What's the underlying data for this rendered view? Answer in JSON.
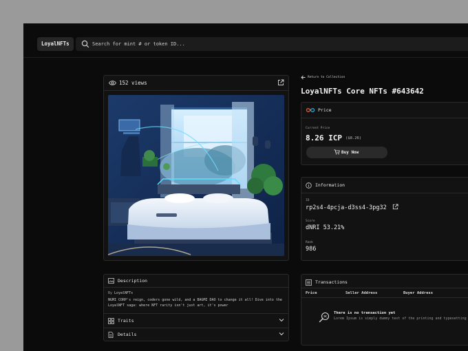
{
  "header": {
    "logo": "LoyalNFTs",
    "search_placeholder": "Search for mint # or token ID..."
  },
  "image_card": {
    "views": "152 views"
  },
  "nav": {
    "back_label": "Return to Collection"
  },
  "nft": {
    "title": "LoyalNFTs Core NFTs #643642"
  },
  "price": {
    "heading": "Price",
    "current_label": "Current Price",
    "value": "8.26 ICP",
    "usd": "($8.26)",
    "buy_label": "Buy Now"
  },
  "information": {
    "heading": "Information",
    "id_label": "ID",
    "id_value": "rp2s4-4pcja-d3ss4-3pg32",
    "score_label": "Score",
    "score_value": "dNRI 53.21%",
    "rank_label": "Rank",
    "rank_value": "986"
  },
  "description": {
    "heading": "Description",
    "by_prefix": "By",
    "by_name": "LoyalNFTs",
    "text": "NGMI CORP's reign, coders gone wild, and a BAGMI DAO to change it all! Dive into the LoyalNFT saga: where NFT rarity isn't just art, it's power"
  },
  "traits": {
    "heading": "Traits"
  },
  "details": {
    "heading": "Details"
  },
  "transactions": {
    "heading": "Transactions",
    "columns": [
      "Price",
      "Seller Address",
      "Buyer Address"
    ],
    "empty_title": "There is no transaction yet",
    "empty_sub": "Lorem Ipsum is simply dummy text of the printing and typesetting"
  },
  "colors": {
    "background": "#0b0b0b",
    "card": "#121212",
    "border": "#2a2a2a",
    "outer": "#9a9a9a"
  }
}
